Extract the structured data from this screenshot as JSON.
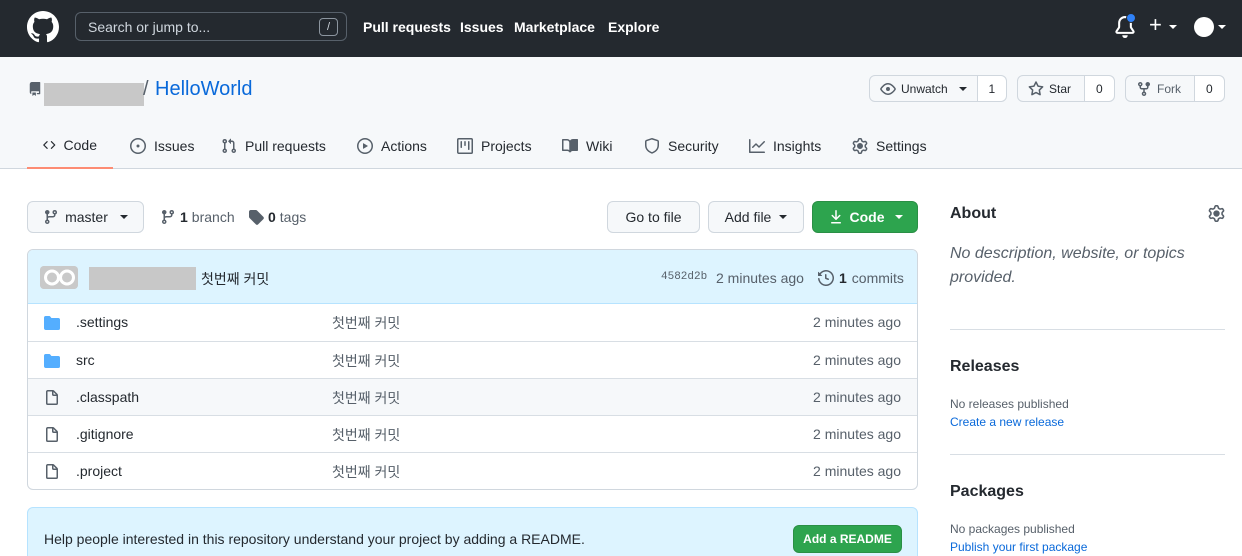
{
  "topbar": {
    "search_placeholder": "Search or jump to...",
    "search_shortcut": "/",
    "nav": [
      "Pull requests",
      "Issues",
      "Marketplace",
      "Explore"
    ],
    "plus_symbol": "+"
  },
  "repo": {
    "slash": "/",
    "name": "HelloWorld",
    "watch_label": "Unwatch",
    "watch_count": "1",
    "star_label": "Star",
    "star_count": "0",
    "fork_label": "Fork",
    "fork_count": "0",
    "tabs": [
      "Code",
      "Issues",
      "Pull requests",
      "Actions",
      "Projects",
      "Wiki",
      "Security",
      "Insights",
      "Settings"
    ]
  },
  "branchbar": {
    "branch": "master",
    "branch_count": "1",
    "branch_word": "branch",
    "tag_count": "0",
    "tag_word": "tags",
    "goto_file": "Go to file",
    "add_file": "Add file",
    "code": "Code"
  },
  "commit": {
    "message": "첫번째 커밋",
    "hash": "4582d2b",
    "time": "2 minutes ago",
    "count": "1",
    "count_word": "commits"
  },
  "files": [
    {
      "name": ".settings",
      "type": "folder",
      "message": "첫번째 커밋",
      "time": "2 minutes ago"
    },
    {
      "name": "src",
      "type": "folder",
      "message": "첫번째 커밋",
      "time": "2 minutes ago"
    },
    {
      "name": ".classpath",
      "type": "file",
      "message": "첫번째 커밋",
      "time": "2 minutes ago"
    },
    {
      "name": ".gitignore",
      "type": "file",
      "message": "첫번째 커밋",
      "time": "2 minutes ago"
    },
    {
      "name": ".project",
      "type": "file",
      "message": "첫번째 커밋",
      "time": "2 minutes ago"
    }
  ],
  "readme": {
    "text": "Help people interested in this repository understand your project by adding a README.",
    "button": "Add a README"
  },
  "sidebar": {
    "about_title": "About",
    "about_desc": "No description, website, or topics provided.",
    "releases_title": "Releases",
    "releases_text": "No releases published",
    "releases_link": "Create a new release",
    "packages_title": "Packages",
    "packages_text": "No packages published",
    "packages_link": "Publish your first package"
  },
  "colors": {
    "header_bg": "#24292f",
    "link": "#0969da",
    "green": "#2da44e",
    "active_tab": "#fd8c73",
    "folder": "#54aeff",
    "notif_dot": "#2f81f7"
  }
}
